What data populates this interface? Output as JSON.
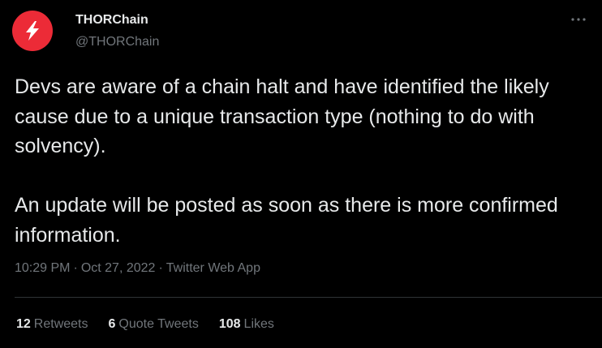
{
  "author": {
    "name": "THORChain",
    "handle": "@THORChain",
    "avatar_color": "#ec2b37",
    "avatar_icon": "lightning-bolt-icon"
  },
  "more_icon": "more-options-icon",
  "tweet": {
    "paragraph_1": "Devs are aware of a chain halt and have identified the likely cause due to a unique transaction type (nothing to do with solvency).",
    "paragraph_2": "An update will be posted as soon as there is more confirmed information."
  },
  "meta": {
    "time": "10:29 PM",
    "separator": "·",
    "date": "Oct 27, 2022",
    "source": "Twitter Web App"
  },
  "stats": [
    {
      "count": "12",
      "label": "Retweets"
    },
    {
      "count": "6",
      "label": "Quote Tweets"
    },
    {
      "count": "108",
      "label": "Likes"
    }
  ],
  "colors": {
    "background": "#000000",
    "text_primary": "#e7e9ea",
    "text_secondary": "#71767b",
    "divider": "#2f3336"
  }
}
